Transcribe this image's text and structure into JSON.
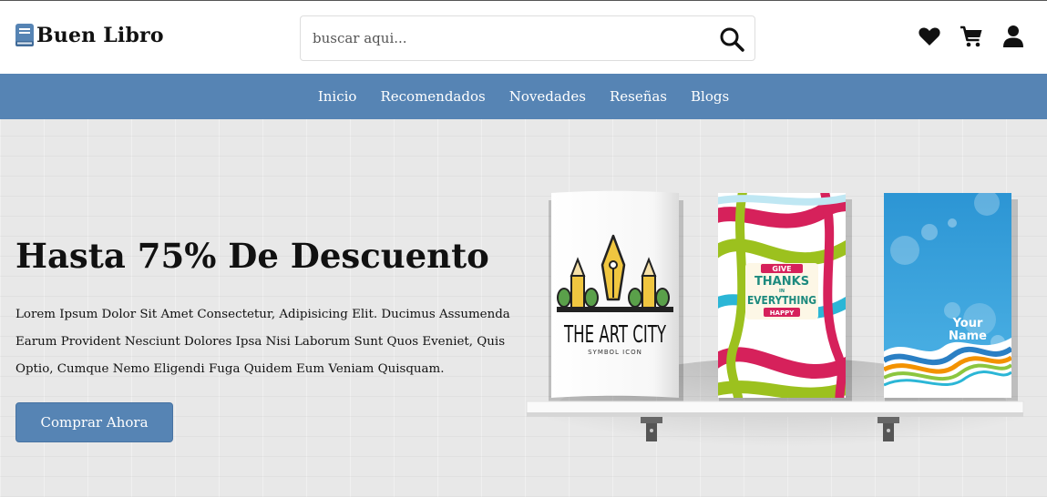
{
  "header": {
    "brand": "Buen Libro",
    "search": {
      "placeholder": "buscar aqui..."
    },
    "icons": [
      "heart-icon",
      "cart-icon",
      "user-icon"
    ]
  },
  "nav": {
    "items": [
      "Inicio",
      "Recomendados",
      "Novedades",
      "Reseñas",
      "Blogs"
    ]
  },
  "hero": {
    "title": "Hasta 75% De Descuento",
    "description": "Lorem Ipsum Dolor Sit Amet Consectetur, Adipisicing Elit. Ducimus Assumenda Earum Provident Nesciunt Dolores Ipsa Nisi Laborum Sunt Quos Eveniet, Quis Optio, Cumque Nemo Eligendi Fuga Quidem Eum Veniam Quisquam.",
    "button": "Comprar Ahora",
    "books": [
      {
        "title": "THE ART CITY",
        "subtitle": "SYMBOL ICON"
      },
      {
        "line1": "GIVE",
        "line2": "THANKS",
        "line3": "IN",
        "line4": "EVERYTHING",
        "line5": "HAPPY"
      },
      {
        "line1": "Your",
        "line2": "Name"
      }
    ]
  },
  "colors": {
    "accent": "#5684b4",
    "text": "#111111",
    "background": "#e8e8e8"
  }
}
